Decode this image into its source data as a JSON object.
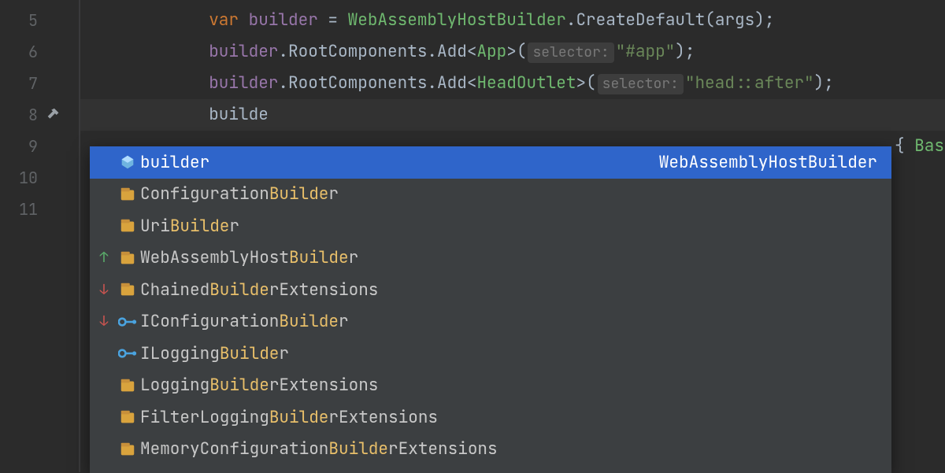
{
  "gutter": {
    "lines": [
      "5",
      "6",
      "7",
      "8",
      "9",
      "10",
      "11"
    ],
    "build_icon_line_index": 3
  },
  "code": {
    "lines": [
      {
        "n": 5,
        "segments": [
          {
            "t": "            ",
            "c": "punc"
          },
          {
            "t": "var ",
            "c": "kw"
          },
          {
            "t": "builder",
            "c": "var"
          },
          {
            "t": " = ",
            "c": "punc"
          },
          {
            "t": "WebAssemblyHostBuilder",
            "c": "type"
          },
          {
            "t": ".",
            "c": "punc"
          },
          {
            "t": "CreateDefault",
            "c": "meth"
          },
          {
            "t": "(args);",
            "c": "punc"
          }
        ]
      },
      {
        "n": 6,
        "segments": [
          {
            "t": "            ",
            "c": "punc"
          },
          {
            "t": "builder",
            "c": "var"
          },
          {
            "t": ".",
            "c": "punc"
          },
          {
            "t": "RootComponents",
            "c": "meth"
          },
          {
            "t": ".",
            "c": "punc"
          },
          {
            "t": "Add",
            "c": "meth"
          },
          {
            "t": "<",
            "c": "punc"
          },
          {
            "t": "App",
            "c": "type"
          },
          {
            "t": ">(",
            "c": "punc"
          },
          {
            "hint": "selector:"
          },
          {
            "t": "\"#app\"",
            "c": "str"
          },
          {
            "t": ");",
            "c": "punc"
          }
        ]
      },
      {
        "n": 7,
        "segments": [
          {
            "t": "            ",
            "c": "punc"
          },
          {
            "t": "builder",
            "c": "var"
          },
          {
            "t": ".",
            "c": "punc"
          },
          {
            "t": "RootComponents",
            "c": "meth"
          },
          {
            "t": ".",
            "c": "punc"
          },
          {
            "t": "Add",
            "c": "meth"
          },
          {
            "t": "<",
            "c": "punc"
          },
          {
            "t": "HeadOutlet",
            "c": "type"
          },
          {
            "t": ">(",
            "c": "punc"
          },
          {
            "hint": "selector:"
          },
          {
            "t": "\"head::after\"",
            "c": "str"
          },
          {
            "t": ");",
            "c": "punc"
          }
        ]
      },
      {
        "n": 8,
        "current": true,
        "segments": [
          {
            "t": "            ",
            "c": "punc"
          },
          {
            "t": "builde",
            "c": "meth"
          }
        ]
      }
    ],
    "overflow_line9": "{ Bas"
  },
  "completion": {
    "typed": "builde",
    "items": [
      {
        "kind": "var",
        "rank": "",
        "parts": [
          {
            "t": "builde",
            "m": true
          },
          {
            "t": "r"
          }
        ],
        "type": "WebAssemblyHostBuilder",
        "selected": true
      },
      {
        "kind": "class",
        "rank": "",
        "parts": [
          {
            "t": "Configuration"
          },
          {
            "t": "Builde",
            "m": true
          },
          {
            "t": "r"
          }
        ],
        "type": ""
      },
      {
        "kind": "class",
        "rank": "",
        "parts": [
          {
            "t": "Uri"
          },
          {
            "t": "Builde",
            "m": true
          },
          {
            "t": "r"
          }
        ],
        "type": ""
      },
      {
        "kind": "class",
        "rank": "up",
        "parts": [
          {
            "t": "WebAssemblyHost"
          },
          {
            "t": "Builde",
            "m": true
          },
          {
            "t": "r"
          }
        ],
        "type": ""
      },
      {
        "kind": "class",
        "rank": "down",
        "parts": [
          {
            "t": "Chained"
          },
          {
            "t": "Builde",
            "m": true
          },
          {
            "t": "rExtensions"
          }
        ],
        "type": ""
      },
      {
        "kind": "interface",
        "rank": "down",
        "parts": [
          {
            "t": "IConfiguration"
          },
          {
            "t": "Builde",
            "m": true
          },
          {
            "t": "r"
          }
        ],
        "type": ""
      },
      {
        "kind": "interface",
        "rank": "",
        "parts": [
          {
            "t": "ILogging"
          },
          {
            "t": "Builde",
            "m": true
          },
          {
            "t": "r"
          }
        ],
        "type": ""
      },
      {
        "kind": "class",
        "rank": "",
        "parts": [
          {
            "t": "Logging"
          },
          {
            "t": "Builde",
            "m": true
          },
          {
            "t": "rExtensions"
          }
        ],
        "type": ""
      },
      {
        "kind": "class",
        "rank": "",
        "parts": [
          {
            "t": "FilterLogging"
          },
          {
            "t": "Builde",
            "m": true
          },
          {
            "t": "rExtensions"
          }
        ],
        "type": ""
      },
      {
        "kind": "class",
        "rank": "",
        "parts": [
          {
            "t": "MemoryConfiguration"
          },
          {
            "t": "Builde",
            "m": true
          },
          {
            "t": "rExtensions"
          }
        ],
        "type": ""
      }
    ]
  },
  "icons": {
    "hammer": "hammer-icon",
    "var": "variable-icon",
    "class": "class-icon",
    "interface": "interface-icon",
    "up": "rank-up-icon",
    "down": "rank-down-icon"
  }
}
